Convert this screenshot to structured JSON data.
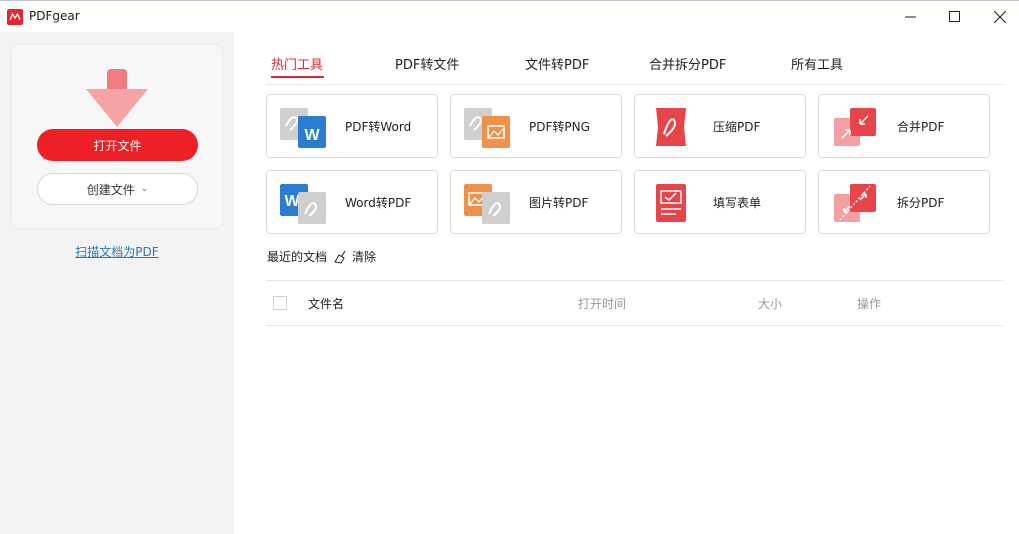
{
  "window": {
    "title": "PDFgear"
  },
  "sidebar": {
    "open_file_label": "打开文件",
    "create_file_label": "创建文件",
    "scan_link_label": "扫描文档为PDF"
  },
  "tabs": [
    {
      "label": "热门工具",
      "active": true
    },
    {
      "label": "PDF转文件",
      "active": false
    },
    {
      "label": "文件转PDF",
      "active": false
    },
    {
      "label": "合并拆分PDF",
      "active": false
    },
    {
      "label": "所有工具",
      "active": false
    }
  ],
  "tools": [
    {
      "label": "PDF转Word",
      "icon": "pdf-to-word-icon"
    },
    {
      "label": "PDF转PNG",
      "icon": "pdf-to-png-icon"
    },
    {
      "label": "压缩PDF",
      "icon": "compress-pdf-icon"
    },
    {
      "label": "合并PDF",
      "icon": "merge-pdf-icon"
    },
    {
      "label": "Word转PDF",
      "icon": "word-to-pdf-icon"
    },
    {
      "label": "图片转PDF",
      "icon": "image-to-pdf-icon"
    },
    {
      "label": "填写表单",
      "icon": "fill-form-icon"
    },
    {
      "label": "拆分PDF",
      "icon": "split-pdf-icon"
    }
  ],
  "recent": {
    "title": "最近的文档",
    "clear_label": "清除",
    "columns": {
      "name": "文件名",
      "opened": "打开时间",
      "size": "大小",
      "actions": "操作"
    }
  },
  "colors": {
    "accent": "#e8262e",
    "link": "#2a7ab8",
    "word_blue": "#2b7cd3",
    "image_orange": "#f0914a"
  }
}
